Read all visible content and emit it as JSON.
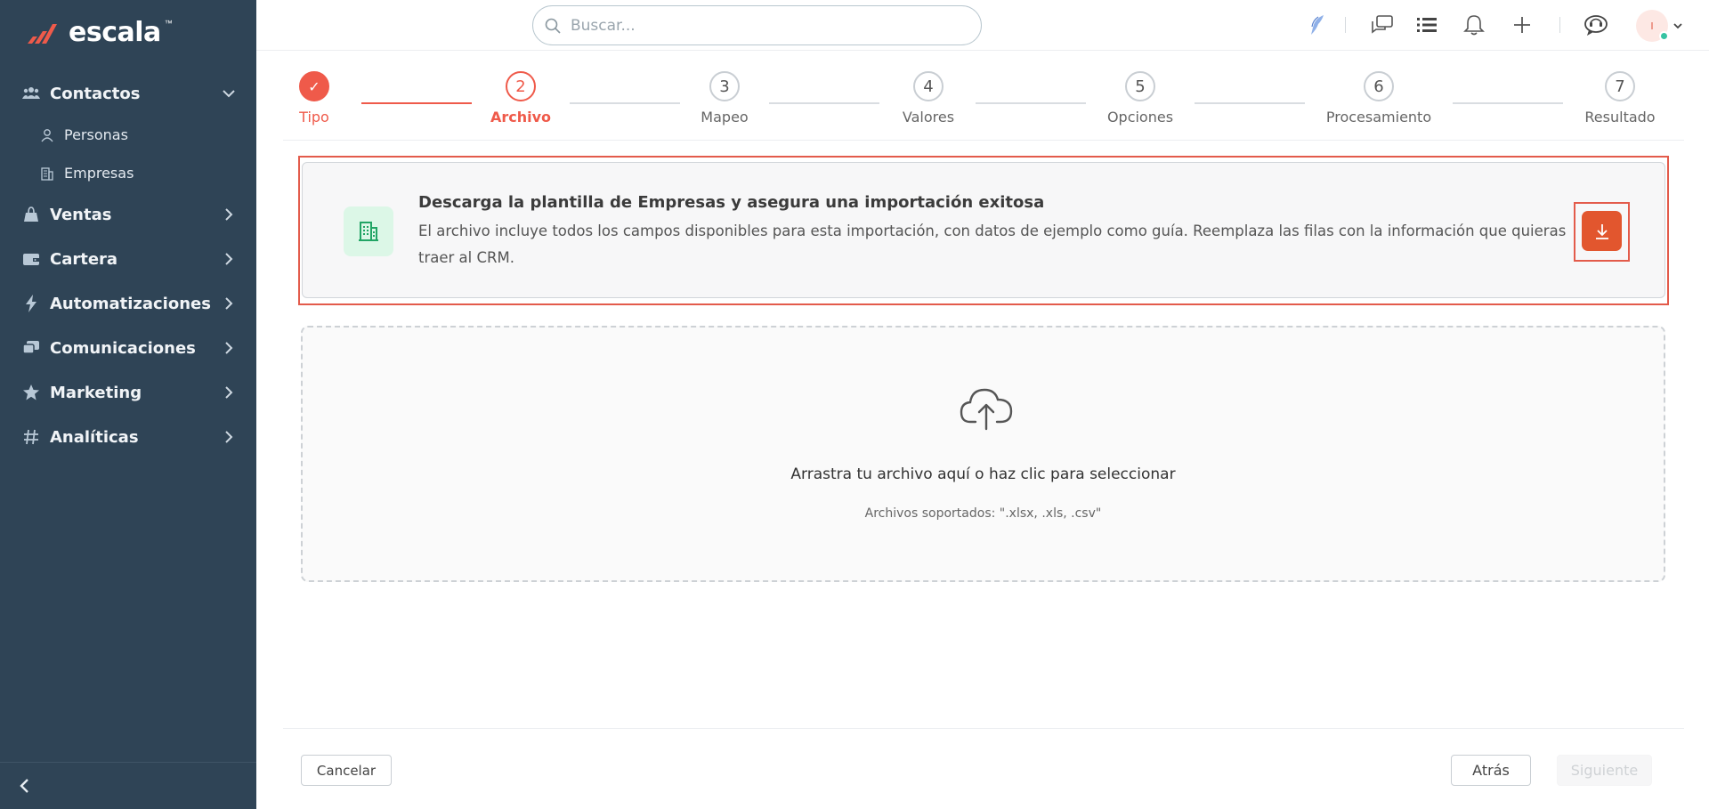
{
  "brand": {
    "name": "escala",
    "tm": "™"
  },
  "sidebar": {
    "items": [
      {
        "label": "Contactos",
        "icon": "contacts-icon",
        "expanded": true,
        "children": [
          {
            "label": "Personas",
            "icon": "person-icon"
          },
          {
            "label": "Empresas",
            "icon": "building-icon"
          }
        ]
      },
      {
        "label": "Ventas",
        "icon": "sales-icon"
      },
      {
        "label": "Cartera",
        "icon": "wallet-icon"
      },
      {
        "label": "Automatizaciones",
        "icon": "bolt-icon"
      },
      {
        "label": "Comunicaciones",
        "icon": "chat-icon"
      },
      {
        "label": "Marketing",
        "icon": "star-icon"
      },
      {
        "label": "Analíticas",
        "icon": "hash-icon"
      }
    ]
  },
  "search": {
    "placeholder": "Buscar..."
  },
  "avatar": {
    "initial": "I"
  },
  "stepper": {
    "steps": [
      {
        "number": "✓",
        "label": "Tipo",
        "state": "done"
      },
      {
        "number": "2",
        "label": "Archivo",
        "state": "active"
      },
      {
        "number": "3",
        "label": "Mapeo",
        "state": "pending"
      },
      {
        "number": "4",
        "label": "Valores",
        "state": "pending"
      },
      {
        "number": "5",
        "label": "Opciones",
        "state": "pending"
      },
      {
        "number": "6",
        "label": "Procesamiento",
        "state": "pending"
      },
      {
        "number": "7",
        "label": "Resultado",
        "state": "pending"
      }
    ]
  },
  "template": {
    "title": "Descarga la plantilla de Empresas y asegura una importación exitosa",
    "description": "El archivo incluye todos los campos disponibles para esta importación, con datos de ejemplo como guía. Reemplaza las filas con la información que quieras traer al CRM."
  },
  "dropzone": {
    "title": "Arrastra tu archivo aquí o haz clic para seleccionar",
    "subtitle": "Archivos soportados: \".xlsx, .xls, .csv\""
  },
  "footer": {
    "cancel": "Cancelar",
    "back": "Atrás",
    "next": "Siguiente"
  },
  "colors": {
    "sidebar": "#2f4456",
    "accent": "#ef5a4a",
    "download": "#e2562e",
    "success_bg": "#dcf7e7",
    "success_fg": "#22a565"
  }
}
